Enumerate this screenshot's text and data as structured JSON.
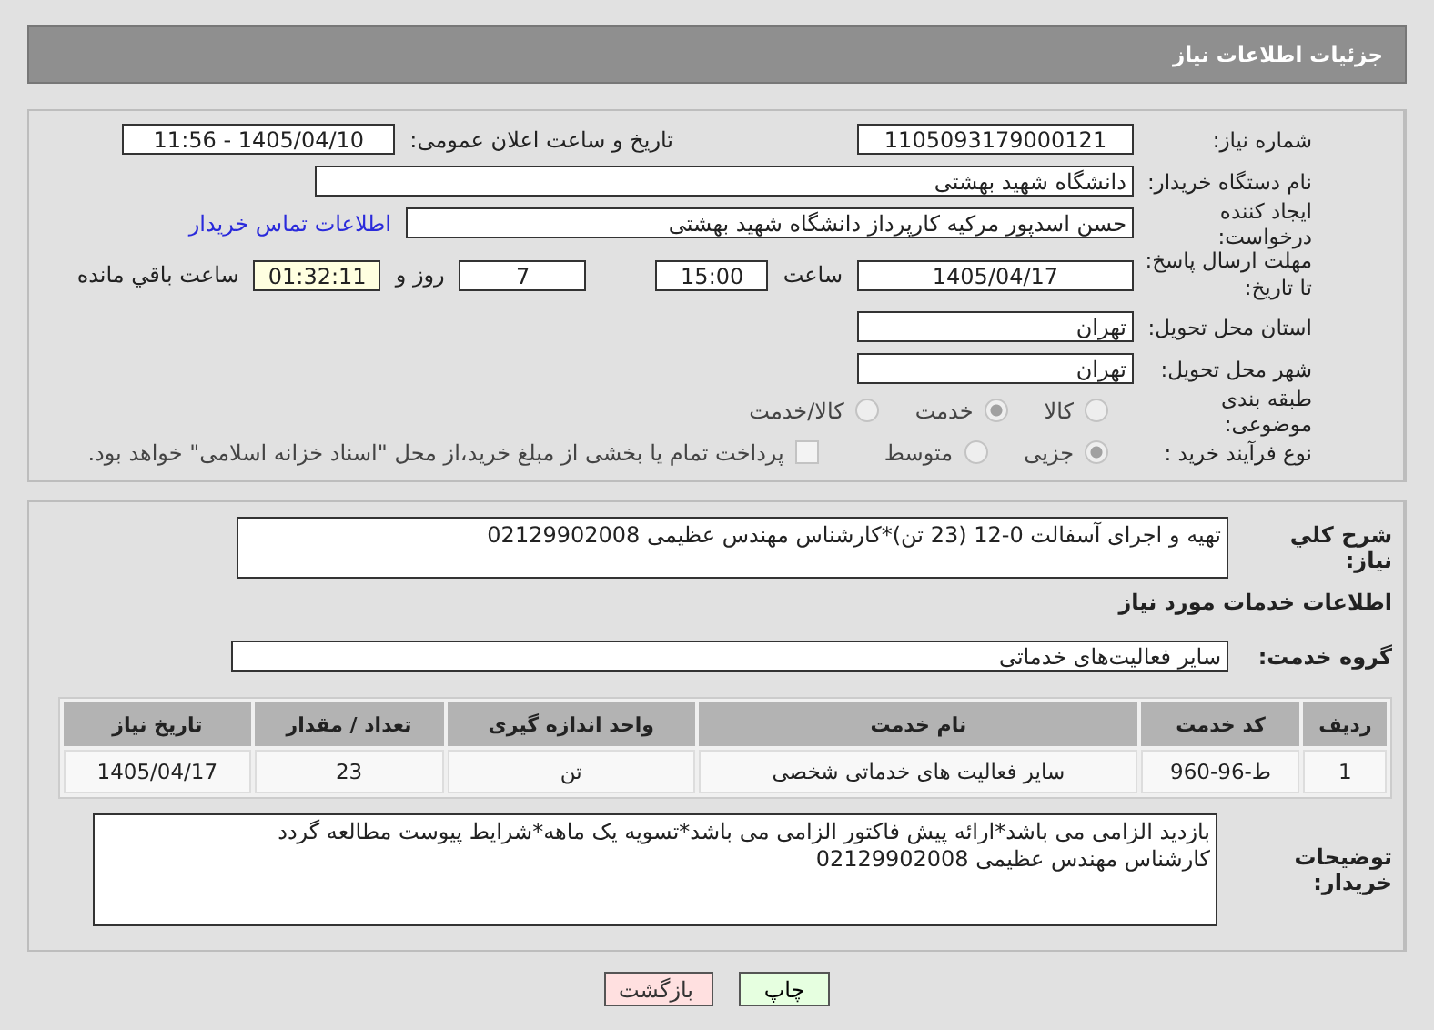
{
  "header": {
    "title": "جزئیات اطلاعات نیاز"
  },
  "need_number": {
    "label": "شماره نیاز:",
    "value": "1105093179000121"
  },
  "announce": {
    "label": "تاریخ و ساعت اعلان عمومی:",
    "value": "1405/04/10 - 11:56"
  },
  "buyer_org": {
    "label": "نام دستگاه خریدار:",
    "value": "دانشگاه شهید بهشتی"
  },
  "requester": {
    "label": "ایجاد کننده درخواست:",
    "value": "حسن اسدپور مرکیه کارپرداز دانشگاه شهید بهشتی",
    "link": "اطلاعات تماس خریدار"
  },
  "deadline": {
    "label": "مهلت ارسال پاسخ: تا تاریخ:",
    "date": "1405/04/17",
    "time_label": "ساعت",
    "time": "15:00",
    "days": "7",
    "days_label": "روز و",
    "remaining": "01:32:11",
    "remaining_label": "ساعت باقي مانده"
  },
  "province": {
    "label": "استان محل تحویل:",
    "value": "تهران"
  },
  "city": {
    "label": "شهر محل تحویل:",
    "value": "تهران"
  },
  "category": {
    "label": "طبقه بندی موضوعی:",
    "options": [
      {
        "label": "کالا",
        "selected": false
      },
      {
        "label": "خدمت",
        "selected": true
      },
      {
        "label": "کالا/خدمت",
        "selected": false
      }
    ]
  },
  "process": {
    "label": "نوع فرآیند خرید :",
    "options": [
      {
        "label": "جزیی",
        "selected": true
      },
      {
        "label": "متوسط",
        "selected": false
      }
    ],
    "payment": {
      "label": "پرداخت تمام یا بخشی از مبلغ خرید،از محل \"اسناد خزانه اسلامی\" خواهد بود.",
      "checked": false
    }
  },
  "description": {
    "label": "شرح کلي نیاز:",
    "value": "تهیه و اجرای آسفالت 0-12 (23 تن)*کارشناس مهندس عظیمی 02129902008"
  },
  "services_title": "اطلاعات خدمات مورد نیاز",
  "service_group": {
    "label": "گروه خدمت:",
    "value": "سایر فعالیت‌های خدماتی"
  },
  "table": {
    "columns": [
      "ردیف",
      "کد خدمت",
      "نام خدمت",
      "واحد اندازه گیری",
      "تعداد / مقدار",
      "تاریخ نیاز"
    ],
    "rows": [
      [
        "1",
        "ط-96-960",
        "سایر فعالیت های خدماتی شخصی",
        "تن",
        "23",
        "1405/04/17"
      ]
    ]
  },
  "buyer_notes": {
    "label": "توضیحات خریدار:",
    "value": "بازدید الزامی می باشد*ارائه پیش فاکتور الزامی می باشد*تسویه یک ماهه*شرایط پیوست مطالعه گردد\nکارشناس مهندس عظیمی 02129902008"
  },
  "buttons": [
    {
      "label": "چاپ",
      "kind": "print"
    },
    {
      "label": "بازگشت",
      "kind": "back"
    }
  ]
}
